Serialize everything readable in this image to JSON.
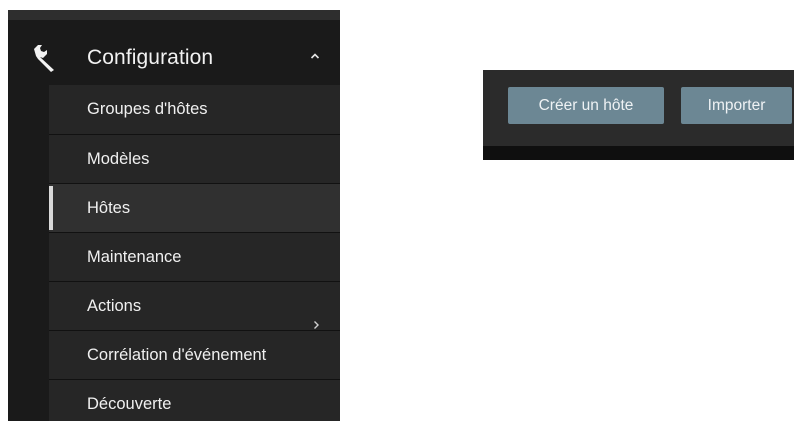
{
  "menu": {
    "section_title": "Configuration",
    "section_icon": "wrench-icon",
    "expanded_icon": "chevron-up-icon",
    "items": [
      {
        "label": "Groupes d'hôtes",
        "selected": false,
        "has_submenu": false
      },
      {
        "label": "Modèles",
        "selected": false,
        "has_submenu": false
      },
      {
        "label": "Hôtes",
        "selected": true,
        "has_submenu": false
      },
      {
        "label": "Maintenance",
        "selected": false,
        "has_submenu": false
      },
      {
        "label": "Actions",
        "selected": false,
        "has_submenu": true
      },
      {
        "label": "Corrélation d'événement",
        "selected": false,
        "has_submenu": false
      },
      {
        "label": "Découverte",
        "selected": false,
        "has_submenu": false
      }
    ]
  },
  "toolbar": {
    "create_host_label": "Créer un hôte",
    "import_label": "Importer"
  },
  "colors": {
    "menu_background": "#1a1a1a",
    "submenu_background": "#262626",
    "selected_indicator": "#d9d9d9",
    "toolbar_background": "#2b2b2b",
    "button_background": "#6c8794",
    "text": "#f0f0f0"
  }
}
